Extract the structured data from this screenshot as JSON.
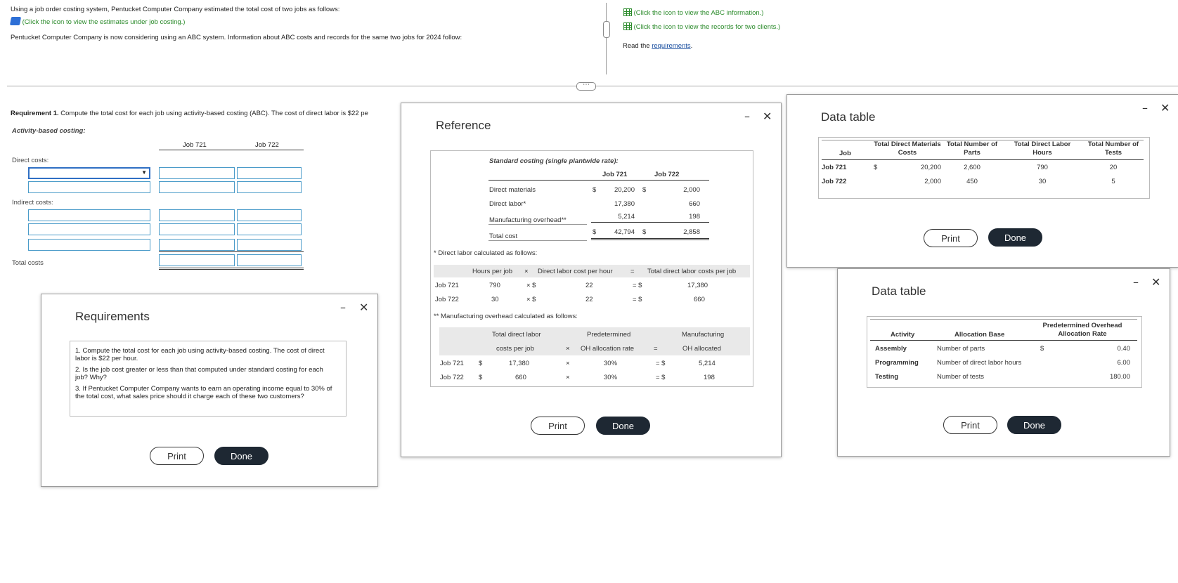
{
  "problem": {
    "line1": "Using a job order costing system, Pentucket Computer Company estimated the total cost of two jobs as follows:",
    "link_estimates": "(Click the icon to view the estimates under job costing.)",
    "line2": "Pentucket Computer Company is now considering using an ABC system. Information about ABC costs and records for the same two jobs for 2024 follow:",
    "link_abc": "(Click the icon to view the ABC information.)",
    "link_records": "(Click the icon to view the records for two clients.)",
    "read_prefix": "Read the ",
    "read_link": "requirements",
    "read_suffix": "."
  },
  "work": {
    "req1_bold": "Requirement 1.",
    "req1_text": " Compute the total cost for each job using activity-based costing (ABC). The cost of direct labor is $22 pe",
    "abc_label": "Activity-based costing:",
    "col1": "Job 721",
    "col2": "Job 722",
    "direct_costs": "Direct costs:",
    "indirect_costs": "Indirect costs:",
    "total_costs": "Total costs"
  },
  "requirements_modal": {
    "title": "Requirements",
    "items": [
      "1.  Compute the total cost for each job using activity-based costing. The cost of direct labor is $22 per hour.",
      "2.  Is the job cost greater or less than that computed under standard costing for each job? Why?",
      "3.  If Pentucket Computer Company wants to earn an operating income equal to 30% of the total cost, what sales price should it charge each of these two customers?"
    ],
    "print": "Print",
    "done": "Done"
  },
  "reference_modal": {
    "title": "Reference",
    "std_title": "Standard costing (single plantwide rate):",
    "col1": "Job 721",
    "col2": "Job 722",
    "rows": [
      {
        "label": "Direct materials",
        "sym1": "$",
        "v1": "20,200",
        "sym2": "$",
        "v2": "2,000"
      },
      {
        "label": "Direct labor*",
        "v1": "17,380",
        "v2": "660"
      },
      {
        "label": "Manufacturing overhead**",
        "v1": "5,214",
        "v2": "198"
      },
      {
        "label": "Total cost",
        "sym1": "$",
        "v1": "42,794",
        "sym2": "$",
        "v2": "2,858"
      }
    ],
    "dl_note": "* Direct labor calculated as follows:",
    "dl_header": {
      "hours": "Hours per job",
      "x": "×",
      "rate": "Direct labor cost per hour",
      "eq": "=",
      "total": "Total direct labor costs per job"
    },
    "dl_rows": [
      {
        "job": "Job 721",
        "hours": "790",
        "x": "× $",
        "rate": "22",
        "eq": "= $",
        "total": "17,380"
      },
      {
        "job": "Job 722",
        "hours": "30",
        "x": "× $",
        "rate": "22",
        "eq": "= $",
        "total": "660"
      }
    ],
    "oh_note": "** Manufacturing overhead calculated as follows:",
    "oh_header": {
      "c1a": "Total direct labor",
      "c1b": "costs per job",
      "x": "×",
      "c2a": "Predetermined",
      "c2b": "OH allocation rate",
      "eq": "=",
      "c3a": "Manufacturing",
      "c3b": "OH allocated"
    },
    "oh_rows": [
      {
        "job": "Job 721",
        "sym": "$",
        "costs": "17,380",
        "x": "×",
        "rate": "30%",
        "eq": "= $",
        "alloc": "5,214"
      },
      {
        "job": "Job 722",
        "sym": "$",
        "costs": "660",
        "x": "×",
        "rate": "30%",
        "eq": "= $",
        "alloc": "198"
      }
    ],
    "print": "Print",
    "done": "Done"
  },
  "data_table_1": {
    "title": "Data table",
    "headers": [
      "Job",
      "Total Direct Materials Costs",
      "Total Number of Parts",
      "Total Direct Labor Hours",
      "Total Number of Tests"
    ],
    "rows": [
      {
        "job": "Job 721",
        "sym": "$",
        "dm": "20,200",
        "parts": "2,600",
        "hours": "790",
        "tests": "20"
      },
      {
        "job": "Job 722",
        "sym": "",
        "dm": "2,000",
        "parts": "450",
        "hours": "30",
        "tests": "5"
      }
    ],
    "print": "Print",
    "done": "Done"
  },
  "data_table_2": {
    "title": "Data table",
    "headers": [
      "Activity",
      "Allocation Base",
      "Predetermined Overhead Allocation Rate"
    ],
    "rows": [
      {
        "activity": "Assembly",
        "base": "Number of parts",
        "sym": "$",
        "rate": "0.40"
      },
      {
        "activity": "Programming",
        "base": "Number of direct labor hours",
        "sym": "",
        "rate": "6.00"
      },
      {
        "activity": "Testing",
        "base": "Number of tests",
        "sym": "",
        "rate": "180.00"
      }
    ],
    "print": "Print",
    "done": "Done"
  },
  "window_controls": {
    "minimize": "–",
    "close": "✕"
  },
  "splitter": {
    "handle": "⋯"
  }
}
